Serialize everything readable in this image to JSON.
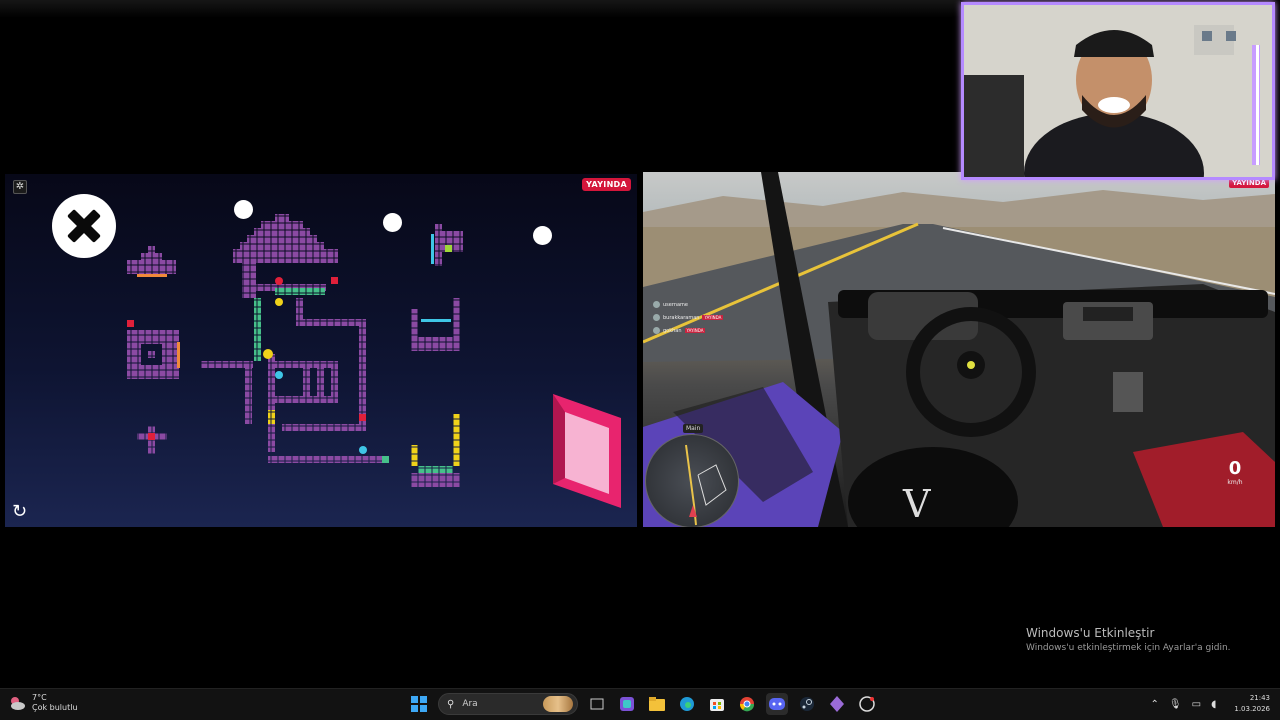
{
  "game_panel": {
    "live_badge": "YAYINDA",
    "settings_icon": "gear-icon",
    "close_icon": "close-icon",
    "undo_icon": "undo-icon",
    "colors": {
      "block": "#8b4aa3",
      "yellow": "#f0d21a",
      "green": "#46c08a",
      "red": "#e0203a",
      "cyan": "#3fc6e6",
      "portal": "#e8246e"
    }
  },
  "drive_panel": {
    "live_badge": "YAYINDA",
    "minimap_label": "Main",
    "speed_value": "0",
    "speed_unit": "km/h",
    "chat_lines": [
      {
        "name": "username",
        "tag": ""
      },
      {
        "name": "burakkaraman",
        "tag": "YAYINDA"
      },
      {
        "name": "gokhan",
        "tag": "YAYINDA"
      }
    ]
  },
  "watermark": {
    "title": "Windows'u Etkinleştir",
    "subtitle": "Windows'u etkinleştirmek için Ayarlar'a gidin."
  },
  "taskbar": {
    "weather_temp": "7°C",
    "weather_desc": "Çok bulutlu",
    "search_placeholder": "Ara",
    "apps": [
      "start-icon",
      "file-manager-icon",
      "m365-icon",
      "folder-icon",
      "edge-icon",
      "store-icon",
      "chrome-icon",
      "discord-icon",
      "steam-icon",
      "game-icon",
      "obs-icon"
    ],
    "time": "21:43",
    "date": "1.03.2026"
  }
}
